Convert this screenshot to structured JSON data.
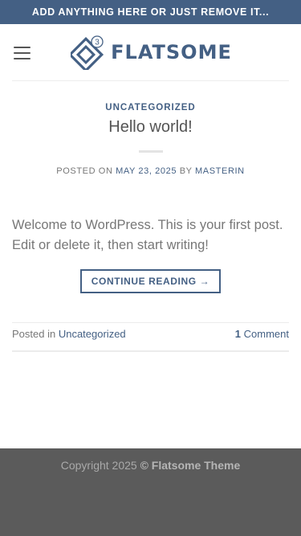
{
  "topbar": {
    "text": "ADD ANYTHING HERE OR JUST REMOVE IT..."
  },
  "header": {
    "logo_text": "FLATSOME",
    "logo_badge": "3"
  },
  "post": {
    "category": "UNCATEGORIZED",
    "title": "Hello world!",
    "meta_posted_on": "POSTED ON",
    "meta_date": "MAY 23, 2025",
    "meta_by": "BY",
    "meta_author": "MASTERIN",
    "excerpt": "Welcome to WordPress. This is your first post. Edit or delete it, then start writing!",
    "read_more": "CONTINUE READING →",
    "footer_posted_in": "Posted in",
    "footer_category": "Uncategorized",
    "footer_comment_count": "1",
    "footer_comment_label": "Comment"
  },
  "footer": {
    "copyright_prefix": "Copyright 2025",
    "copyright_brand": "© Flatsome Theme"
  },
  "colors": {
    "primary": "#446084",
    "topbar_bg": "#446084",
    "footer_bg": "#5b5b5b",
    "text": "#777777"
  }
}
